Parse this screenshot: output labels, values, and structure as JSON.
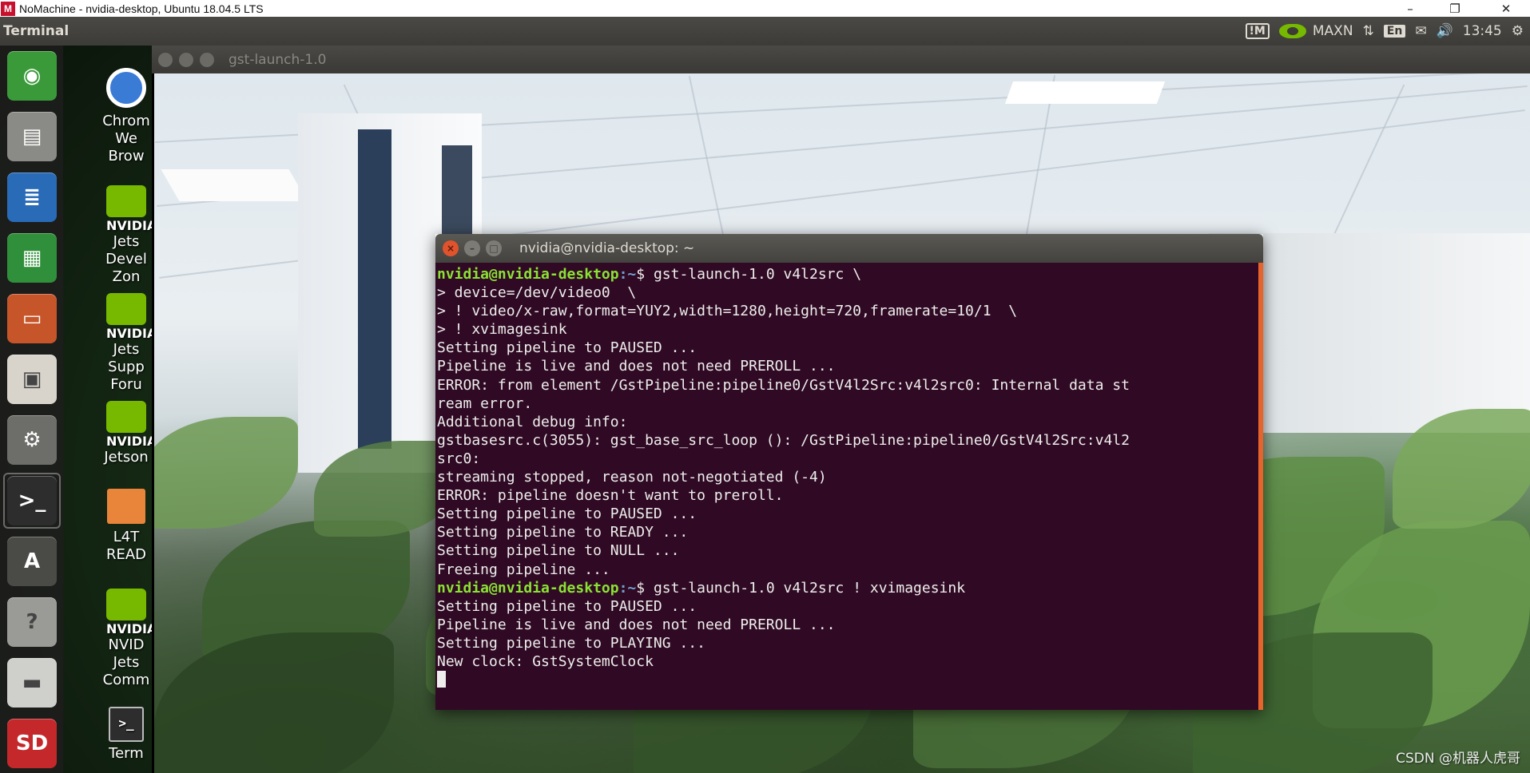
{
  "host_window": {
    "logo": "M",
    "title": "NoMachine - nvidia-desktop, Ubuntu 18.04.5 LTS",
    "minimize": "–",
    "restore": "❐",
    "close": "✕"
  },
  "top_panel": {
    "app_name": "Terminal",
    "nomachine_indicator": "!M",
    "power_mode": "MAXN",
    "network_icon": "⇅",
    "keyboard": "En",
    "mail_icon": "✉",
    "volume_icon": "🔊",
    "clock": "13:45",
    "settings_icon": "⚙"
  },
  "launcher": [
    {
      "name": "ubuntu-dash",
      "glyph": "◉",
      "color": "#3a9a3a"
    },
    {
      "name": "files",
      "glyph": "▤",
      "color": "#8a8a86"
    },
    {
      "name": "writer",
      "glyph": "≣",
      "color": "#2a6bb8"
    },
    {
      "name": "calc",
      "glyph": "▦",
      "color": "#2f8f3a"
    },
    {
      "name": "impress",
      "glyph": "▭",
      "color": "#c7552a"
    },
    {
      "name": "software",
      "glyph": "▣",
      "color": "#d8d4cc"
    },
    {
      "name": "system-settings",
      "glyph": "⚙",
      "color": "#6d6d6a"
    },
    {
      "name": "terminal",
      "glyph": ">_",
      "color": "#2d2d2d"
    },
    {
      "name": "software-updater",
      "glyph": "A",
      "color": "#4a4a46"
    },
    {
      "name": "help",
      "glyph": "?",
      "color": "#9a9a96"
    },
    {
      "name": "drive",
      "glyph": "▬",
      "color": "#cfcfcb"
    },
    {
      "name": "sd-card",
      "glyph": "SD",
      "color": "#c4282a"
    }
  ],
  "desktop_icons": [
    {
      "label": "Chrom\nWe\nBrow"
    },
    {
      "label": "Jets\nDevel\nZon"
    },
    {
      "label": "Jets\nSupp\nForu"
    },
    {
      "label": "Jetson"
    },
    {
      "label": "L4T\nREAD"
    },
    {
      "label": "NVID\nJets\nComm"
    },
    {
      "label": "Term"
    }
  ],
  "gst_window": {
    "title": "gst-launch-1.0"
  },
  "terminal": {
    "title": "nvidia@nvidia-desktop: ~",
    "prompt_user": "nvidia@nvidia-desktop",
    "prompt_path": ":~",
    "lines": [
      {
        "type": "cmd",
        "text": "$ gst-launch-1.0 v4l2src \\"
      },
      {
        "type": "out",
        "text": "> device=/dev/video0  \\"
      },
      {
        "type": "out",
        "text": "> ! video/x-raw,format=YUY2,width=1280,height=720,framerate=10/1  \\"
      },
      {
        "type": "out",
        "text": "> ! xvimagesink"
      },
      {
        "type": "out",
        "text": "Setting pipeline to PAUSED ..."
      },
      {
        "type": "out",
        "text": "Pipeline is live and does not need PREROLL ..."
      },
      {
        "type": "out",
        "text": "ERROR: from element /GstPipeline:pipeline0/GstV4l2Src:v4l2src0: Internal data st"
      },
      {
        "type": "out",
        "text": "ream error."
      },
      {
        "type": "out",
        "text": "Additional debug info:"
      },
      {
        "type": "out",
        "text": "gstbasesrc.c(3055): gst_base_src_loop (): /GstPipeline:pipeline0/GstV4l2Src:v4l2"
      },
      {
        "type": "out",
        "text": "src0:"
      },
      {
        "type": "out",
        "text": "streaming stopped, reason not-negotiated (-4)"
      },
      {
        "type": "out",
        "text": "ERROR: pipeline doesn't want to preroll."
      },
      {
        "type": "out",
        "text": "Setting pipeline to PAUSED ..."
      },
      {
        "type": "out",
        "text": "Setting pipeline to READY ..."
      },
      {
        "type": "out",
        "text": "Setting pipeline to NULL ..."
      },
      {
        "type": "out",
        "text": "Freeing pipeline ..."
      },
      {
        "type": "cmd",
        "text": "$ gst-launch-1.0 v4l2src ! xvimagesink"
      },
      {
        "type": "out",
        "text": "Setting pipeline to PAUSED ..."
      },
      {
        "type": "out",
        "text": "Pipeline is live and does not need PREROLL ..."
      },
      {
        "type": "out",
        "text": "Setting pipeline to PLAYING ..."
      },
      {
        "type": "out",
        "text": "New clock: GstSystemClock"
      },
      {
        "type": "cursor",
        "text": ""
      }
    ]
  },
  "watermark": "CSDN @机器人虎哥"
}
